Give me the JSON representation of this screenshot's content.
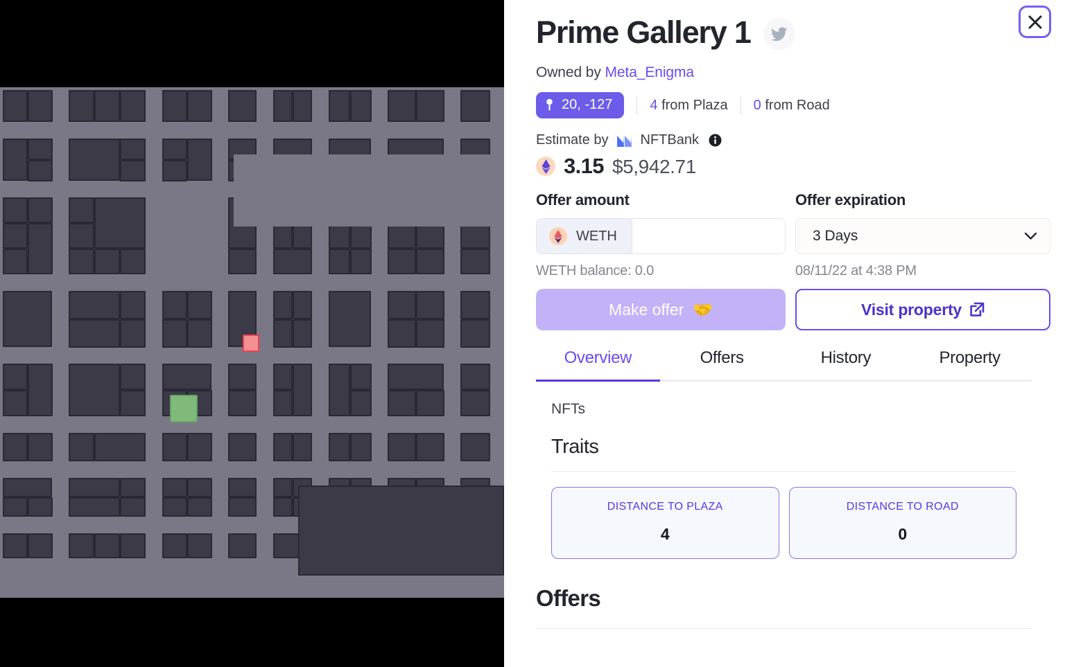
{
  "window": {
    "close_label": "×"
  },
  "header": {
    "title": "Prime Gallery 1",
    "twitter_icon": "twitter-icon",
    "owned_by_prefix": "Owned by ",
    "owner_name": "Meta_Enigma",
    "coordinates": "20, -127",
    "pin_icon": "map-pin-icon",
    "plaza_distance": "4",
    "plaza_label": " from Plaza",
    "road_distance": "0",
    "road_label": " from Road"
  },
  "estimate": {
    "prefix": "Estimate by ",
    "provider": "NFTBank",
    "provider_icon": "nftbank-icon",
    "info_icon": "info-icon",
    "eth_icon": "ethereum-icon",
    "eth_value": "3.15",
    "usd_value": "$5,942.71"
  },
  "offer_form": {
    "amount_label": "Offer amount",
    "currency": "WETH",
    "currency_icon": "weth-icon",
    "amount_value": "",
    "amount_placeholder": "",
    "balance_note": "WETH balance: 0.0",
    "expiration_label": "Offer expiration",
    "expiration_value": "3 Days",
    "expiration_options": [
      "3 Days"
    ],
    "chevron_icon": "chevron-down-icon",
    "expiration_date": "08/11/22 at 4:38 PM",
    "make_offer_label": "Make offer",
    "make_offer_icon": "handshake-icon",
    "visit_property_label": "Visit property",
    "visit_property_icon": "external-link-icon"
  },
  "tabs": [
    {
      "label": "Overview",
      "active": true
    },
    {
      "label": "Offers",
      "active": false
    },
    {
      "label": "History",
      "active": false
    },
    {
      "label": "Property",
      "active": false
    }
  ],
  "overview": {
    "nfts_label": "NFTs",
    "traits_label": "Traits",
    "traits": [
      {
        "name": "DISTANCE TO PLAZA",
        "value": "4"
      },
      {
        "name": "DISTANCE TO ROAD",
        "value": "0"
      }
    ],
    "offers_heading": "Offers"
  },
  "colors": {
    "accent_purple": "#6d4aeb",
    "badge_purple": "#6c5ce9",
    "button_purple_light": "#c3b2f7",
    "map_road": "#7a7886",
    "map_parcel": "#3c3a47",
    "selected_parcel": "#f4908f",
    "owned_parcel": "#7fba7a"
  },
  "map": {
    "selected_parcel_label": "selected-parcel",
    "owned_parcel_label": "owned-parcel"
  }
}
